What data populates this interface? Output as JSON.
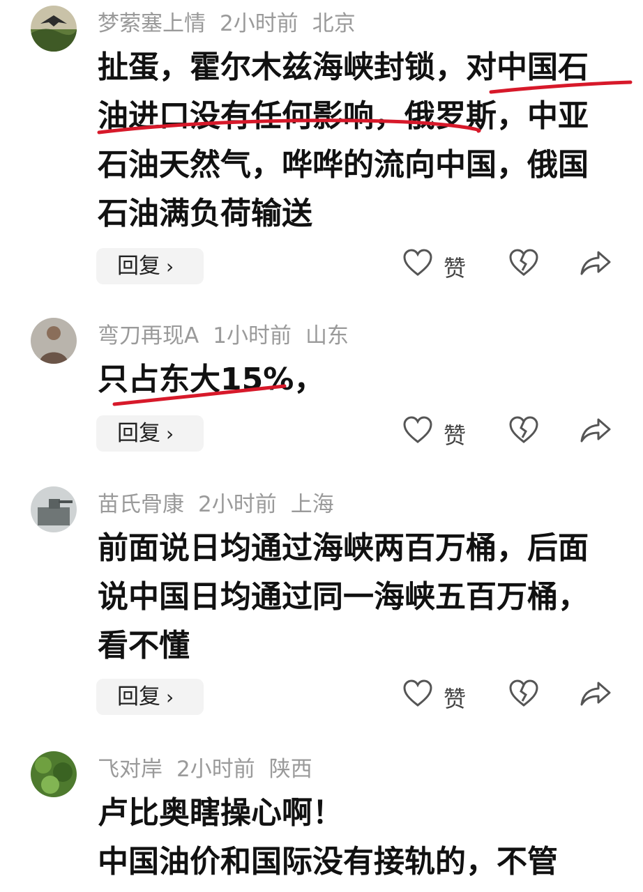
{
  "comments": [
    {
      "user": "梦萦塞上情",
      "time": "2小时前",
      "location": "北京",
      "text": "扯蛋，霍尔木兹海峡封锁，对中国石油进口没有任何影响，俄罗斯，中亚石油天然气，哗哗的流向中国，俄国石油满负荷输送",
      "reply_label": "回复",
      "like_label": "赞"
    },
    {
      "user": "弯刀再现A",
      "time": "1小时前",
      "location": "山东",
      "text": "只占东大15%，",
      "reply_label": "回复",
      "like_label": "赞"
    },
    {
      "user": "苗氏骨康",
      "time": "2小时前",
      "location": "上海",
      "text": "前面说日均通过海峡两百万桶，后面说中国日均通过同一海峡五百万桶，看不懂",
      "reply_label": "回复",
      "like_label": "赞"
    },
    {
      "user": "飞对岸",
      "time": "2小时前",
      "location": "陕西",
      "text_line1": "卢比奥瞎操心啊！",
      "text_line2": "中国油价和国际没有接轨的，不管"
    }
  ],
  "icons": {
    "like": "heart-outline-icon",
    "dislike": "broken-heart-icon",
    "share": "share-arrow-icon",
    "reply_chevron": "chevron-right-icon"
  },
  "colors": {
    "highlight_stroke": "#d7192a",
    "meta_text": "#9a9a9a",
    "body_text": "#111111",
    "reply_bg": "#f3f3f3"
  }
}
